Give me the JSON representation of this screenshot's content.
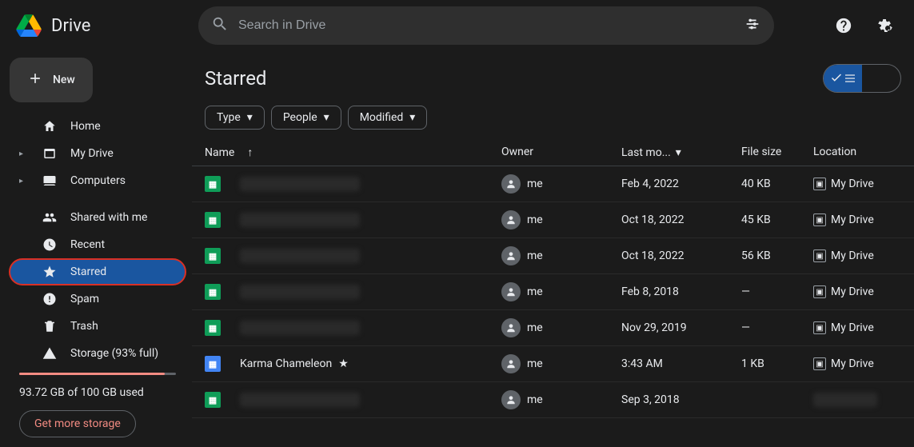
{
  "app": {
    "name": "Drive"
  },
  "search": {
    "placeholder": "Search in Drive"
  },
  "sidebar": {
    "new_label": "New",
    "items": [
      {
        "label": "Home"
      },
      {
        "label": "My Drive"
      },
      {
        "label": "Computers"
      },
      {
        "label": "Shared with me"
      },
      {
        "label": "Recent"
      },
      {
        "label": "Starred"
      },
      {
        "label": "Spam"
      },
      {
        "label": "Trash"
      },
      {
        "label": "Storage (93% full)"
      }
    ],
    "storage_used": "93.72 GB of 100 GB used",
    "storage_percent": 93,
    "get_storage": "Get more storage"
  },
  "page": {
    "title": "Starred",
    "filters": [
      {
        "label": "Type"
      },
      {
        "label": "People"
      },
      {
        "label": "Modified"
      }
    ],
    "columns": {
      "name": "Name",
      "owner": "Owner",
      "modified": "Last mo...",
      "size": "File size",
      "location": "Location"
    },
    "rows": [
      {
        "type": "sheet",
        "name": "",
        "redacted": true,
        "owner": "me",
        "modified": "Feb 4, 2022",
        "size": "40 KB",
        "location": "My Drive"
      },
      {
        "type": "sheet",
        "name": "",
        "redacted": true,
        "owner": "me",
        "modified": "Oct 18, 2022",
        "size": "45 KB",
        "location": "My Drive"
      },
      {
        "type": "sheet",
        "name": "",
        "redacted": true,
        "owner": "me",
        "modified": "Oct 18, 2022",
        "size": "56 KB",
        "location": "My Drive"
      },
      {
        "type": "sheet",
        "name": "",
        "redacted": true,
        "owner": "me",
        "modified": "Feb 8, 2018",
        "size": "—",
        "location": "My Drive"
      },
      {
        "type": "sheet",
        "name": "",
        "redacted": true,
        "owner": "me",
        "modified": "Nov 29, 2019",
        "size": "—",
        "location": "My Drive"
      },
      {
        "type": "doc",
        "name": "Karma Chameleon",
        "redacted": false,
        "starred": true,
        "owner": "me",
        "modified": "3:43 AM",
        "size": "1 KB",
        "location": "My Drive"
      },
      {
        "type": "sheet",
        "name": "",
        "redacted": true,
        "owner": "me",
        "modified": "Sep 3, 2018",
        "size": "",
        "location": "",
        "loc_redacted": true
      }
    ]
  }
}
